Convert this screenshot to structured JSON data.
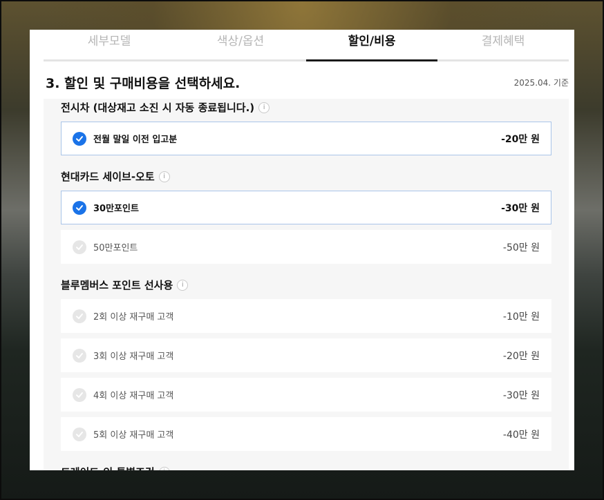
{
  "tabs": [
    {
      "label": "세부모델"
    },
    {
      "label": "색상/옵션"
    },
    {
      "label": "할인/비용"
    },
    {
      "label": "결제혜택"
    }
  ],
  "section": {
    "title": "3. 할인 및 구매비용을 선택하세요.",
    "ref_date": "2025.04. 기준"
  },
  "groups": [
    {
      "title": "전시차 (대상재고 소진 시 자동 종료됩니다.)",
      "info": "i",
      "options": [
        {
          "label": "전월 말일 이전 입고분",
          "price": "-20만 원",
          "selected": true
        }
      ]
    },
    {
      "title": "현대카드 세이브-오토",
      "info": "i",
      "options": [
        {
          "label": "30만포인트",
          "price": "-30만 원",
          "selected": true
        },
        {
          "label": "50만포인트",
          "price": "-50만 원",
          "selected": false
        }
      ]
    },
    {
      "title": "블루멤버스 포인트 선사용",
      "info": "i",
      "options": [
        {
          "label": "2회 이상 재구매 고객",
          "price": "-10만 원",
          "selected": false
        },
        {
          "label": "3회 이상 재구매 고객",
          "price": "-20만 원",
          "selected": false
        },
        {
          "label": "4회 이상 재구매 고객",
          "price": "-30만 원",
          "selected": false
        },
        {
          "label": "5회 이상 재구매 고객",
          "price": "-40만 원",
          "selected": false
        }
      ]
    },
    {
      "title": "트레이드-인 특별조건",
      "info": "i",
      "options": []
    }
  ],
  "colors": {
    "accent": "#1a73e8",
    "selected_border": "#a9c4e8",
    "inactive_tab": "#b5b5b5"
  },
  "icons": {
    "check": "check-icon",
    "info": "info-icon"
  }
}
